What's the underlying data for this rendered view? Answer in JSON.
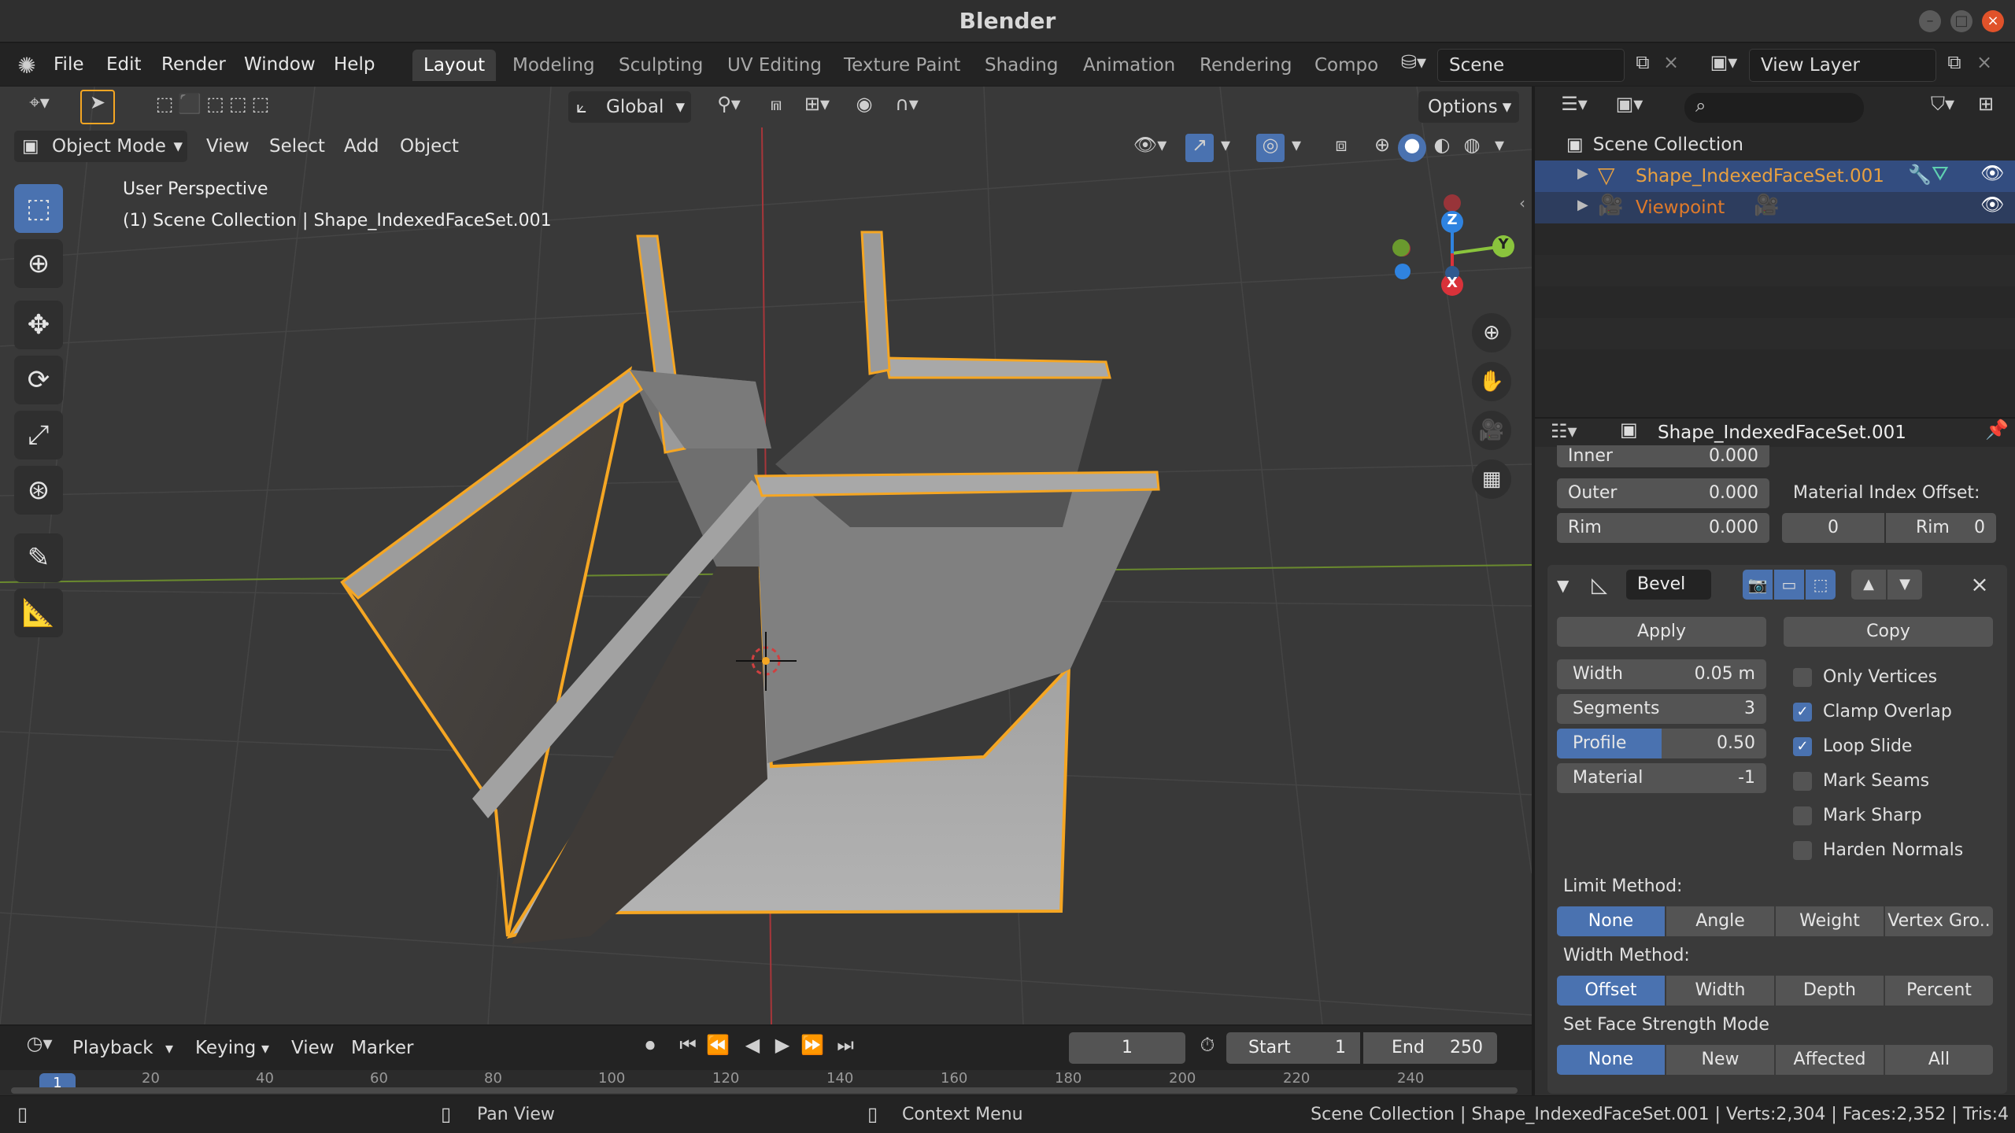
{
  "window": {
    "title": "Blender"
  },
  "menus": [
    "File",
    "Edit",
    "Render",
    "Window",
    "Help"
  ],
  "workspaces": [
    "Layout",
    "Modeling",
    "Sculpting",
    "UV Editing",
    "Texture Paint",
    "Shading",
    "Animation",
    "Rendering",
    "Compo"
  ],
  "scene": {
    "name": "Scene",
    "view_layer": "View Layer"
  },
  "viewport": {
    "transform_orientation": "Global",
    "options_label": "Options",
    "mode": "Object Mode",
    "menus": [
      "View",
      "Select",
      "Add",
      "Object"
    ],
    "overlay_title": "User Perspective",
    "overlay_subtitle": "(1) Scene Collection | Shape_IndexedFaceSet.001",
    "gizmo": {
      "z": "Z",
      "y": "Y",
      "x": "X"
    }
  },
  "timeline": {
    "menus": [
      "Playback",
      "Keying",
      "View",
      "Marker"
    ],
    "current_frame": "1",
    "start_label": "Start",
    "start": "1",
    "end_label": "End",
    "end": "250",
    "ruler": [
      "1",
      "20",
      "40",
      "60",
      "80",
      "100",
      "120",
      "140",
      "160",
      "180",
      "200",
      "220",
      "240"
    ]
  },
  "outliner": {
    "collection": "Scene Collection",
    "items": [
      {
        "name": "Shape_IndexedFaceSet.001",
        "color": "#e8a040"
      },
      {
        "name": "Viewpoint",
        "color": "#e07a2a"
      }
    ]
  },
  "properties": {
    "object_name": "Shape_IndexedFaceSet.001",
    "solidify": {
      "inner_label": "Inner",
      "inner": "0.000",
      "outer_label": "Outer",
      "outer": "0.000",
      "rim_label": "Rim",
      "rim": "0.000",
      "material_offset_label": "Material Index Offset:",
      "mat_offset": "0",
      "rim2_label": "Rim",
      "mat_rim": "0"
    },
    "bevel": {
      "name": "Bevel",
      "apply": "Apply",
      "copy": "Copy",
      "width_label": "Width",
      "width": "0.05 m",
      "segments_label": "Segments",
      "segments": "3",
      "profile_label": "Profile",
      "profile": "0.50",
      "profile_fill": 0.5,
      "material_label": "Material",
      "material": "-1",
      "checks": [
        {
          "label": "Only Vertices",
          "checked": false
        },
        {
          "label": "Clamp Overlap",
          "checked": true
        },
        {
          "label": "Loop Slide",
          "checked": true
        },
        {
          "label": "Mark Seams",
          "checked": false
        },
        {
          "label": "Mark Sharp",
          "checked": false
        },
        {
          "label": "Harden Normals",
          "checked": false
        }
      ],
      "limit_method_label": "Limit Method:",
      "limit_methods": [
        "None",
        "Angle",
        "Weight",
        "Vertex Gro.."
      ],
      "width_method_label": "Width Method:",
      "width_methods": [
        "Offset",
        "Width",
        "Depth",
        "Percent"
      ],
      "face_strength_label": "Set Face Strength Mode",
      "face_strength": [
        "None",
        "New",
        "Affected",
        "All"
      ]
    }
  },
  "statusbar": {
    "pan_view": "Pan View",
    "context_menu": "Context Menu",
    "stats": "Scene Collection | Shape_IndexedFaceSet.001 | Verts:2,304 | Faces:2,352 | Tris:4"
  },
  "colors": {
    "accent": "#4a72b0",
    "selection_outline": "#f5a623",
    "x_axis": "#d9323a",
    "y_axis": "#8ac43d",
    "z_axis": "#2f83e0"
  }
}
